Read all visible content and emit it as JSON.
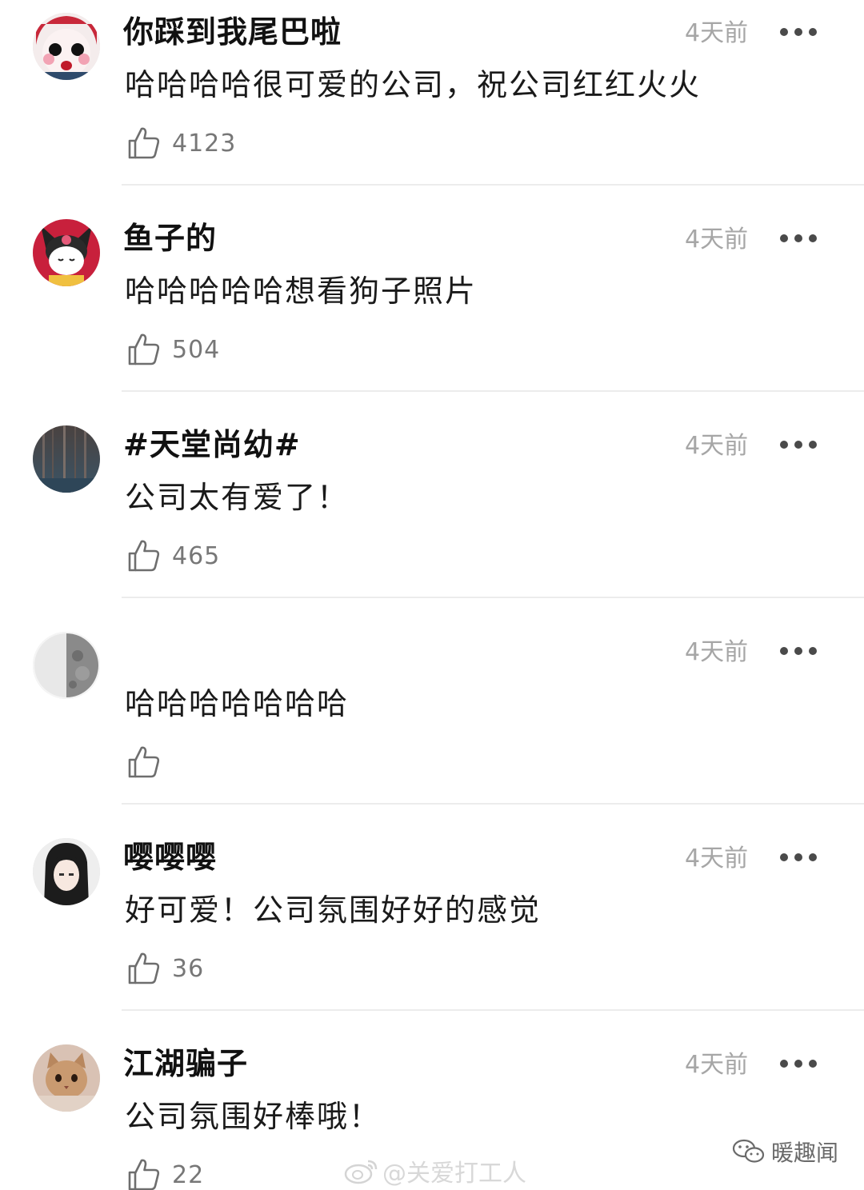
{
  "comments": [
    {
      "username": "你踩到我尾巴啦",
      "time": "4天前",
      "text": "哈哈哈哈很可爱的公司，祝公司红红火火",
      "likes": "4123",
      "avatar": "clown-face-avatar"
    },
    {
      "username": "鱼子的",
      "time": "4天前",
      "text": "哈哈哈哈哈想看狗子照片",
      "likes": "504",
      "avatar": "kuromi-avatar"
    },
    {
      "username": "#天堂尚幼#",
      "time": "4天前",
      "text": "公司太有爱了！",
      "likes": "465",
      "avatar": "forest-avatar"
    },
    {
      "username": "",
      "time": "4天前",
      "text": "哈哈哈哈哈哈哈",
      "likes": "",
      "avatar": "moon-avatar"
    },
    {
      "username": "嘤嘤嘤",
      "time": "4天前",
      "text": "好可爱！公司氛围好好的感觉",
      "likes": "36",
      "avatar": "anime-girl-avatar"
    },
    {
      "username": "江湖骗子",
      "time": "4天前",
      "text": "公司氛围好棒哦！",
      "likes": "22",
      "avatar": "cat-avatar"
    }
  ],
  "watermarks": {
    "weibo": "@关爱打工人",
    "wechat": "暖趣闻"
  },
  "icons": {
    "like": "thumbs-up-icon",
    "more": "more-dots-icon",
    "weibo": "weibo-logo-icon",
    "wechat": "wechat-logo-icon"
  },
  "colors": {
    "username": "#111111",
    "time": "#a6a6a6",
    "like_count": "#777777",
    "divider": "#ececec"
  }
}
